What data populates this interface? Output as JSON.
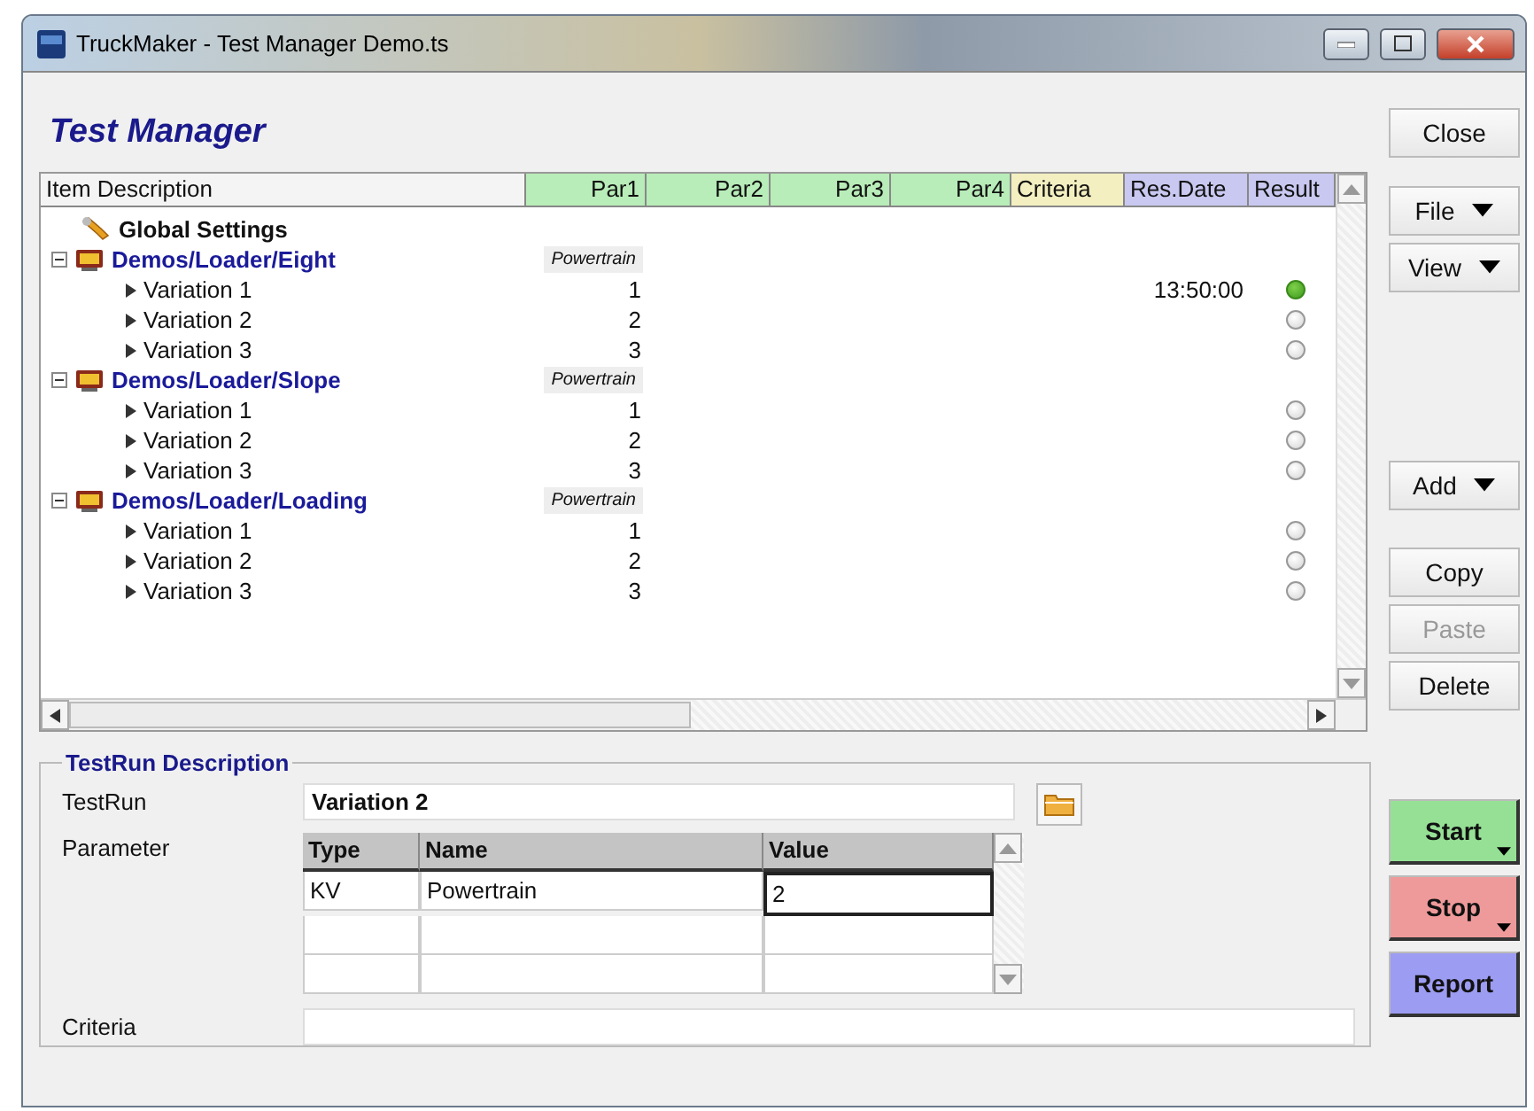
{
  "window": {
    "title": "TruckMaker - Test Manager Demo.ts"
  },
  "heading": "Test Manager",
  "tree": {
    "columns": [
      {
        "label": "Item Description",
        "kind": "name"
      },
      {
        "label": "Par1",
        "kind": "par"
      },
      {
        "label": "Par2",
        "kind": "par"
      },
      {
        "label": "Par3",
        "kind": "par"
      },
      {
        "label": "Par4",
        "kind": "par"
      },
      {
        "label": "Criteria",
        "kind": "criteria"
      },
      {
        "label": "Res.Date",
        "kind": "result"
      },
      {
        "label": "Result",
        "kind": "result"
      }
    ],
    "items": [
      {
        "kind": "settings",
        "label": "Global Settings"
      },
      {
        "kind": "group",
        "label": "Demos/Loader/Eight",
        "expanded": true,
        "par1": "Powertrain",
        "children": [
          {
            "label": "Variation 1",
            "par1": "1",
            "res_date": "13:50:00",
            "passed": true
          },
          {
            "label": "Variation 2",
            "par1": "2",
            "passed": false
          },
          {
            "label": "Variation 3",
            "par1": "3",
            "passed": false
          }
        ]
      },
      {
        "kind": "group",
        "label": "Demos/Loader/Slope",
        "expanded": true,
        "par1": "Powertrain",
        "children": [
          {
            "label": "Variation 1",
            "par1": "1",
            "passed": false
          },
          {
            "label": "Variation 2",
            "par1": "2",
            "passed": false
          },
          {
            "label": "Variation 3",
            "par1": "3",
            "passed": false
          }
        ]
      },
      {
        "kind": "group",
        "label": "Demos/Loader/Loading",
        "expanded": true,
        "par1": "Powertrain",
        "children": [
          {
            "label": "Variation 1",
            "par1": "1",
            "passed": false
          },
          {
            "label": "Variation 2",
            "par1": "2",
            "passed": false
          },
          {
            "label": "Variation 3",
            "par1": "3",
            "passed": false
          }
        ]
      }
    ]
  },
  "testrun": {
    "title": "TestRun Description",
    "testrun_label": "TestRun",
    "testrun_value": "Variation 2",
    "parameter_label": "Parameter",
    "parameter_columns": [
      "Type",
      "Name",
      "Value"
    ],
    "parameter_rows": [
      {
        "type": "KV",
        "name": "Powertrain",
        "value": "2"
      }
    ],
    "criteria_label": "Criteria"
  },
  "button_groups": [
    [
      {
        "label": "Close",
        "kind": "plain",
        "disabled": false
      }
    ],
    [
      {
        "label": "File",
        "kind": "menu",
        "disabled": false
      },
      {
        "label": "View",
        "kind": "menu",
        "disabled": false
      }
    ],
    [
      {
        "label": "Add",
        "kind": "menu",
        "disabled": false
      }
    ],
    [
      {
        "label": "Copy",
        "kind": "plain",
        "disabled": false
      },
      {
        "label": "Paste",
        "kind": "plain",
        "disabled": true
      },
      {
        "label": "Delete",
        "kind": "plain",
        "disabled": false
      }
    ],
    [
      {
        "label": "Start",
        "kind": "split",
        "color": "#96e096"
      },
      {
        "label": "Stop",
        "kind": "split",
        "color": "#ef9a9a"
      },
      {
        "label": "Report",
        "kind": "action",
        "color": "#9c9cf2"
      }
    ]
  ]
}
